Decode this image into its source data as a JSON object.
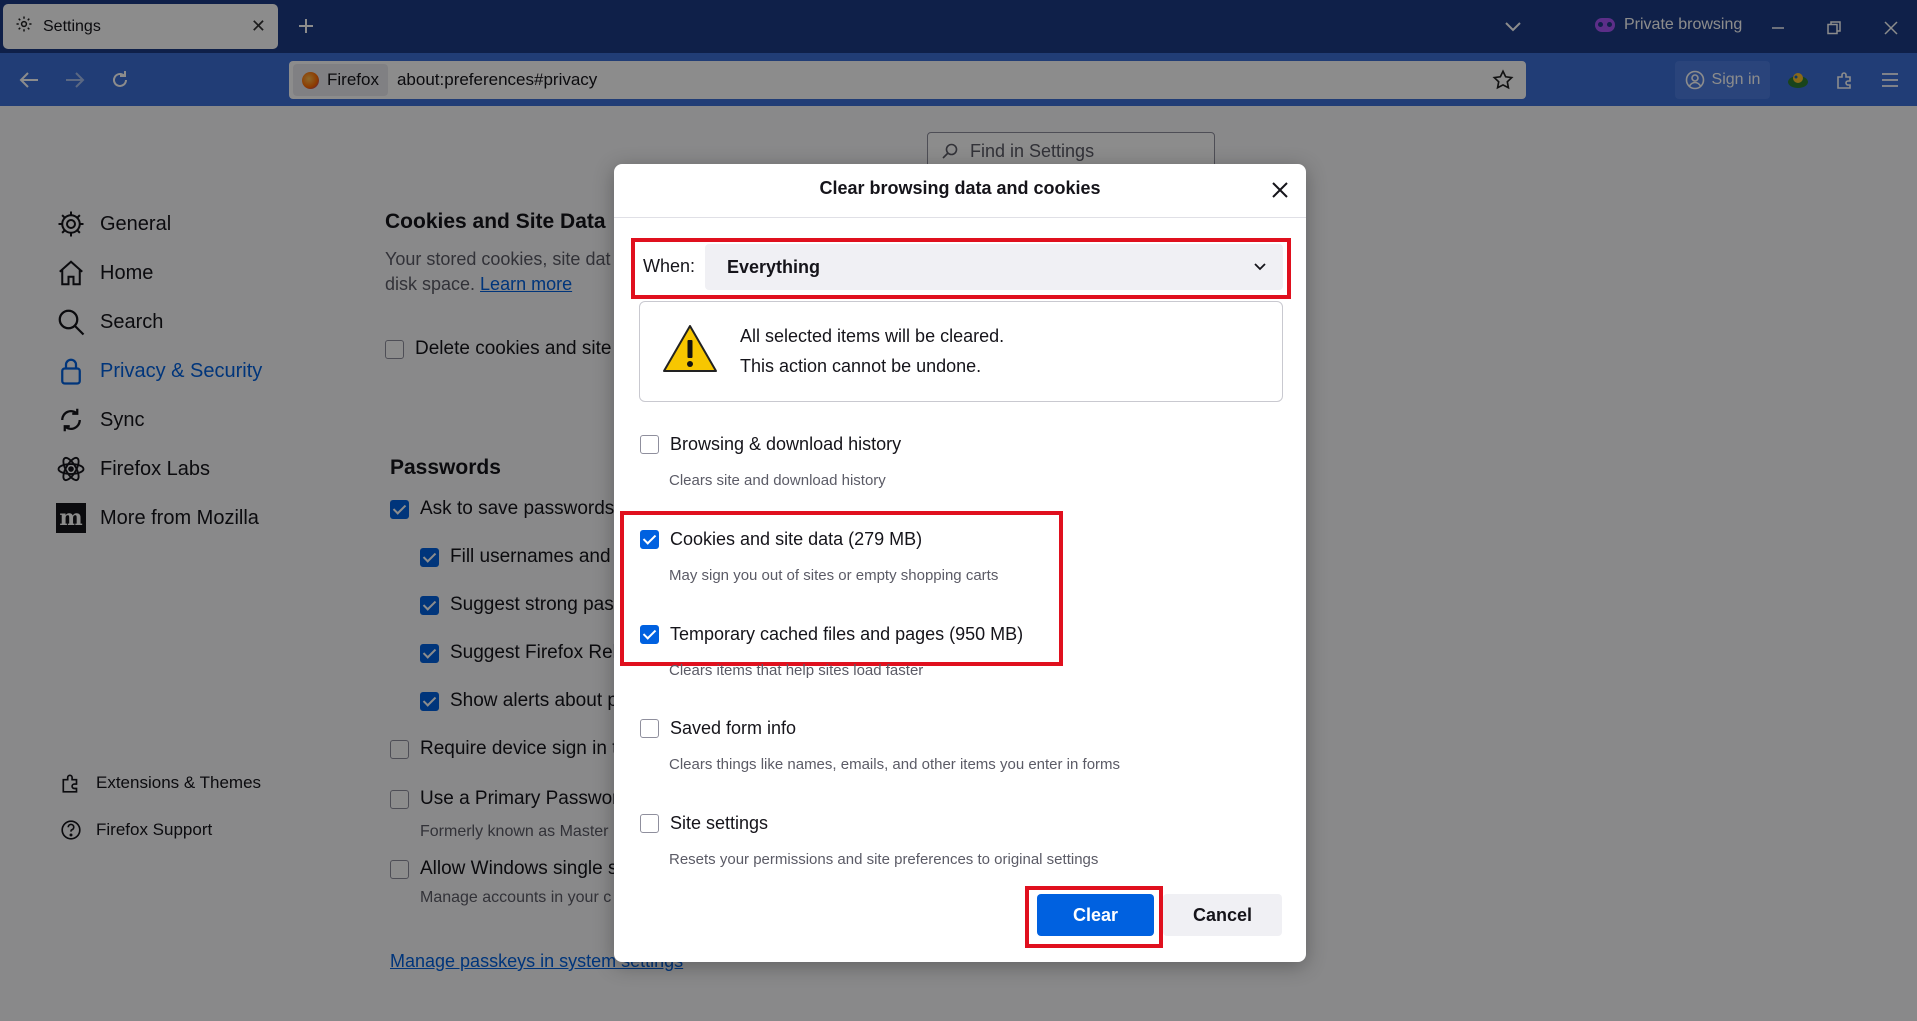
{
  "browser": {
    "tab": {
      "title": "Settings",
      "icon": "gear-icon"
    },
    "private_label": "Private browsing",
    "identity_label": "Firefox",
    "url": "about:preferences#privacy",
    "signin_label": "Sign in",
    "colors": {
      "titlebar": "#1c3b85",
      "navbar": "#3c6fd8",
      "accent": "#0061e0",
      "highlight": "#e0101e"
    }
  },
  "settings": {
    "find_placeholder": "Find in Settings",
    "nav": [
      {
        "label": "General",
        "icon": "gear-icon"
      },
      {
        "label": "Home",
        "icon": "home-icon"
      },
      {
        "label": "Search",
        "icon": "search-icon"
      },
      {
        "label": "Privacy & Security",
        "icon": "lock-icon"
      },
      {
        "label": "Sync",
        "icon": "sync-icon"
      },
      {
        "label": "Firefox Labs",
        "icon": "atom-icon"
      },
      {
        "label": "More from Mozilla",
        "icon": "mozilla-icon"
      }
    ],
    "footer_nav": [
      {
        "label": "Extensions & Themes",
        "icon": "puzzle-icon"
      },
      {
        "label": "Firefox Support",
        "icon": "help-icon"
      }
    ],
    "cookies": {
      "title": "Cookies and Site Data",
      "desc_line1": "Your stored cookies, site dat",
      "desc_line2": "disk space. ",
      "learn_more": "Learn more",
      "delete_label": "Delete cookies and site c"
    },
    "passwords": {
      "title": "Passwords",
      "items": [
        {
          "label": "Ask to save passwords",
          "checked": true
        },
        {
          "label": "Fill usernames and p",
          "checked": true
        },
        {
          "label": "Suggest strong pass",
          "checked": true
        },
        {
          "label": "Suggest Firefox Rela",
          "checked": true
        },
        {
          "label": "Show alerts about p",
          "checked": true
        },
        {
          "label": "Require device sign in to",
          "checked": false
        },
        {
          "label": "Use a Primary Password",
          "checked": false
        },
        {
          "label": "Allow Windows single s",
          "checked": false
        }
      ],
      "primary_note": "Formerly known as Master",
      "windows_note": "Manage accounts in your c",
      "passkeys_link": "Manage passkeys in system settings"
    }
  },
  "dialog": {
    "title": "Clear browsing data and cookies",
    "when_label": "When:",
    "when_value": "Everything",
    "warning_line1": "All selected items will be cleared.",
    "warning_line2": "This action cannot be undone.",
    "items": [
      {
        "label": "Browsing & download history",
        "desc": "Clears site and download history",
        "checked": false
      },
      {
        "label": "Cookies and site data (279 MB)",
        "desc": "May sign you out of sites or empty shopping carts",
        "checked": true
      },
      {
        "label": "Temporary cached files and pages (950 MB)",
        "desc": "Clears items that help sites load faster",
        "checked": true
      },
      {
        "label": "Saved form info",
        "desc": "Clears things like names, emails, and other items you enter in forms",
        "checked": false
      },
      {
        "label": "Site settings",
        "desc": "Resets your permissions and site preferences to original settings",
        "checked": false
      }
    ],
    "clear_label": "Clear",
    "cancel_label": "Cancel"
  }
}
